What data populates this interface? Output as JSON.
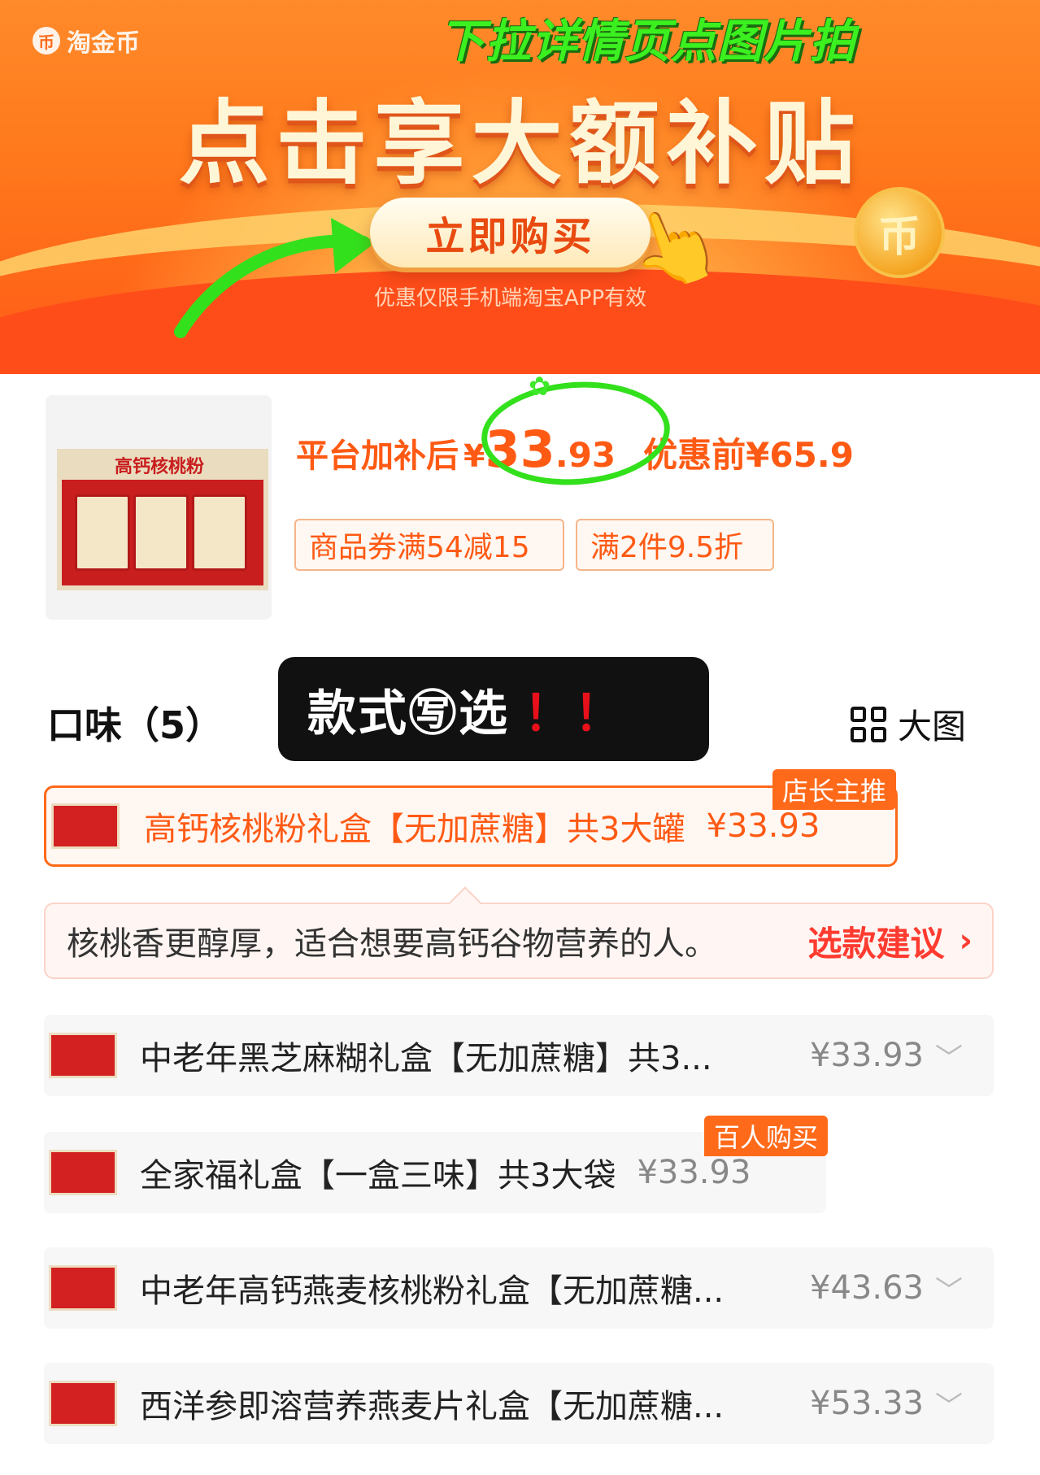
{
  "banner": {
    "brand": "淘金币",
    "brand_coin_glyph": "币",
    "overlay_title": "下拉详情页点图片拍",
    "headline": "点击享大额补贴",
    "buy_button": "立即购买",
    "note": "优惠仅限手机端淘宝APP有效",
    "coin_glyph": "币",
    "colors": {
      "orange": "#ff7a1c",
      "overlay_green": "#3cf020"
    }
  },
  "product": {
    "image_title": "高钙核桃粉",
    "price_label": "平台加补后",
    "price_currency": "¥",
    "price_int": "33",
    "price_dec": ".93",
    "original_label": "优惠前¥65.9",
    "coupons": [
      "商品券满54减15",
      "满2件9.5折"
    ]
  },
  "variants_header": {
    "flavor": "口味（5）",
    "style_badge": "款式㊢选",
    "style_badge_marks": "！！",
    "big_image": "大图"
  },
  "selected_variant": {
    "name": "高钙核桃粉礼盒【无加蔗糖】共3大罐",
    "price": "¥33.93",
    "tag": "店长主推"
  },
  "advice": {
    "text": "核桃香更醇厚，适合想要高钙谷物营养的人。",
    "link": "选款建议",
    "chevron": "›"
  },
  "variants": [
    {
      "name": "中老年黑芝麻糊礼盒【无加蔗糖】共3...",
      "price": "¥33.93",
      "chevron": "﹀"
    },
    {
      "name": "全家福礼盒【一盒三味】共3大袋",
      "price": "¥33.93",
      "tag": "百人购买"
    },
    {
      "name": "中老年高钙燕麦核桃粉礼盒【无加蔗糖...",
      "price": "¥43.63",
      "chevron": "﹀"
    },
    {
      "name": "西洋参即溶营养燕麦片礼盒【无加蔗糖...",
      "price": "¥53.33",
      "chevron": "﹀"
    }
  ]
}
